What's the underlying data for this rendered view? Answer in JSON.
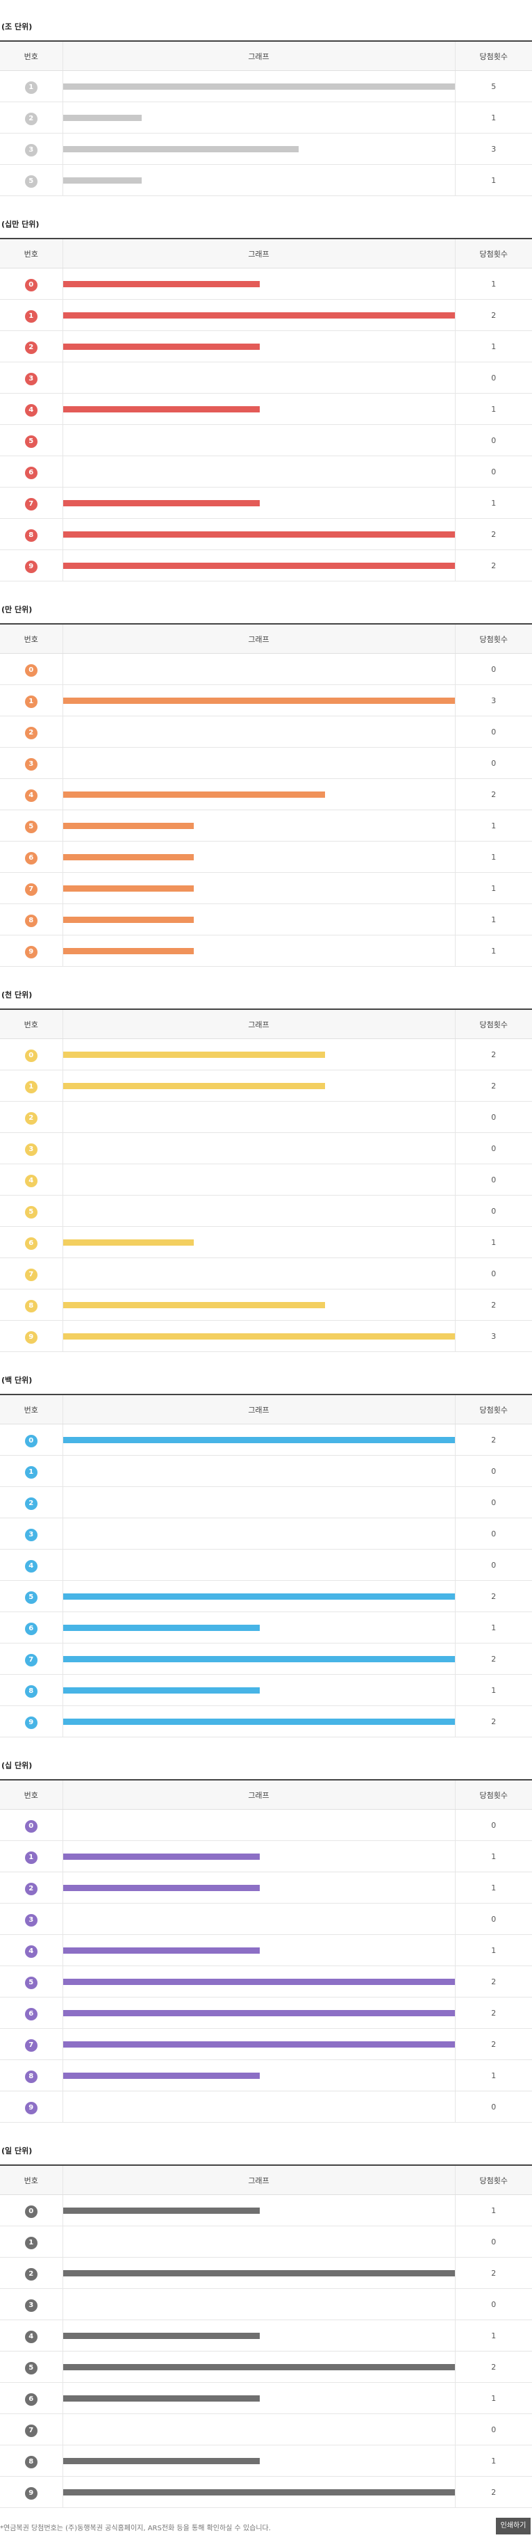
{
  "header": {
    "col_number": "번호",
    "col_graph": "그래프",
    "col_count": "당첨횟수"
  },
  "sections": [
    {
      "title": "(조 단위)",
      "color": "#c8c8c8",
      "max": 5,
      "rows": [
        {
          "n": "1",
          "c": 5
        },
        {
          "n": "2",
          "c": 1
        },
        {
          "n": "3",
          "c": 3
        },
        {
          "n": "5",
          "c": 1
        }
      ]
    },
    {
      "title": "(십만 단위)",
      "color": "#e35b57",
      "max": 2,
      "rows": [
        {
          "n": "0",
          "c": 1
        },
        {
          "n": "1",
          "c": 2
        },
        {
          "n": "2",
          "c": 1
        },
        {
          "n": "3",
          "c": 0
        },
        {
          "n": "4",
          "c": 1
        },
        {
          "n": "5",
          "c": 0
        },
        {
          "n": "6",
          "c": 0
        },
        {
          "n": "7",
          "c": 1
        },
        {
          "n": "8",
          "c": 2
        },
        {
          "n": "9",
          "c": 2
        }
      ]
    },
    {
      "title": "(만 단위)",
      "color": "#f0925a",
      "max": 3,
      "rows": [
        {
          "n": "0",
          "c": 0
        },
        {
          "n": "1",
          "c": 3
        },
        {
          "n": "2",
          "c": 0
        },
        {
          "n": "3",
          "c": 0
        },
        {
          "n": "4",
          "c": 2
        },
        {
          "n": "5",
          "c": 1
        },
        {
          "n": "6",
          "c": 1
        },
        {
          "n": "7",
          "c": 1
        },
        {
          "n": "8",
          "c": 1
        },
        {
          "n": "9",
          "c": 1
        }
      ]
    },
    {
      "title": "(천 단위)",
      "color": "#f3cf60",
      "max": 3,
      "rows": [
        {
          "n": "0",
          "c": 2
        },
        {
          "n": "1",
          "c": 2
        },
        {
          "n": "2",
          "c": 0
        },
        {
          "n": "3",
          "c": 0
        },
        {
          "n": "4",
          "c": 0
        },
        {
          "n": "5",
          "c": 0
        },
        {
          "n": "6",
          "c": 1
        },
        {
          "n": "7",
          "c": 0
        },
        {
          "n": "8",
          "c": 2
        },
        {
          "n": "9",
          "c": 3
        }
      ]
    },
    {
      "title": "(백 단위)",
      "color": "#47b4e6",
      "max": 2,
      "rows": [
        {
          "n": "0",
          "c": 2
        },
        {
          "n": "1",
          "c": 0
        },
        {
          "n": "2",
          "c": 0
        },
        {
          "n": "3",
          "c": 0
        },
        {
          "n": "4",
          "c": 0
        },
        {
          "n": "5",
          "c": 2
        },
        {
          "n": "6",
          "c": 1
        },
        {
          "n": "7",
          "c": 2
        },
        {
          "n": "8",
          "c": 1
        },
        {
          "n": "9",
          "c": 2
        }
      ]
    },
    {
      "title": "(십 단위)",
      "color": "#8c6fc5",
      "max": 2,
      "rows": [
        {
          "n": "0",
          "c": 0
        },
        {
          "n": "1",
          "c": 1
        },
        {
          "n": "2",
          "c": 1
        },
        {
          "n": "3",
          "c": 0
        },
        {
          "n": "4",
          "c": 1
        },
        {
          "n": "5",
          "c": 2
        },
        {
          "n": "6",
          "c": 2
        },
        {
          "n": "7",
          "c": 2
        },
        {
          "n": "8",
          "c": 1
        },
        {
          "n": "9",
          "c": 0
        }
      ]
    },
    {
      "title": "(일 단위)",
      "color": "#6f6f6f",
      "max": 2,
      "rows": [
        {
          "n": "0",
          "c": 1
        },
        {
          "n": "1",
          "c": 0
        },
        {
          "n": "2",
          "c": 2
        },
        {
          "n": "3",
          "c": 0
        },
        {
          "n": "4",
          "c": 1
        },
        {
          "n": "5",
          "c": 2
        },
        {
          "n": "6",
          "c": 1
        },
        {
          "n": "7",
          "c": 0
        },
        {
          "n": "8",
          "c": 1
        },
        {
          "n": "9",
          "c": 2
        }
      ]
    }
  ],
  "footer": {
    "note": "*연금복권 당첨번호는 (주)동행복권 공식홈페이지, ARS전화 등을 통해 확인하실 수 있습니다.",
    "print_label": "인쇄하기"
  }
}
